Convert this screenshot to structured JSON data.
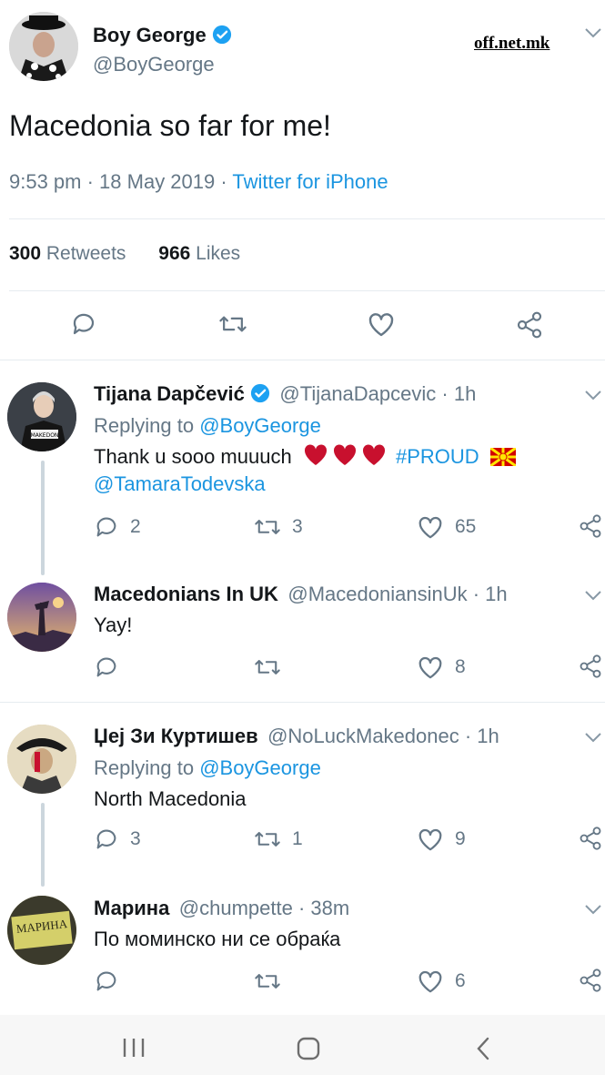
{
  "watermark": "off.net.mk",
  "tweet": {
    "author_name": "Boy George",
    "author_handle": "@BoyGeorge",
    "text": "Macedonia so far for me!",
    "time": "9:53 pm · 18 May 2019 · ",
    "source": "Twitter for iPhone",
    "retweets_count": "300",
    "retweets_label": " Retweets",
    "likes_count": "966",
    "likes_label": " Likes"
  },
  "replies": [
    {
      "name": "Tijana Dapčević",
      "handle": "@TijanaDapcevic · 1h",
      "replying_prefix": "Replying to ",
      "replying_to": "@BoyGeorge",
      "text": "Thank u sooo muuuch",
      "hashtag": "#PROUD",
      "mention": "@TamaraTodevska",
      "reply_count": "2",
      "retweet_count": "3",
      "like_count": "65"
    },
    {
      "name": "Macedonians In UK",
      "handle": "@MacedoniansinUk · 1h",
      "text": "Yay!",
      "reply_count": "",
      "retweet_count": "",
      "like_count": "8"
    },
    {
      "name": "Џеј Зи Куртишев",
      "handle": "@NoLuckMakedonec · 1h",
      "replying_prefix": "Replying to ",
      "replying_to": "@BoyGeorge",
      "text": "North Macedonia",
      "reply_count": "3",
      "retweet_count": "1",
      "like_count": "9"
    },
    {
      "name": "Марина",
      "handle": "@chumpette · 38m",
      "text": "По моминско ни се обраќа",
      "avatar_text": "МАРИНА",
      "reply_count": "",
      "retweet_count": "",
      "like_count": "6"
    }
  ],
  "icons": {
    "reply": "reply-icon",
    "retweet": "retweet-icon",
    "like": "heart-icon",
    "share": "share-icon",
    "verified": "verified-badge-icon",
    "chevron": "chevron-down-icon"
  },
  "colors": {
    "link": "#1b95e0",
    "verified": "#1da1f2",
    "heart": "#e0245e",
    "muted": "#657786"
  }
}
